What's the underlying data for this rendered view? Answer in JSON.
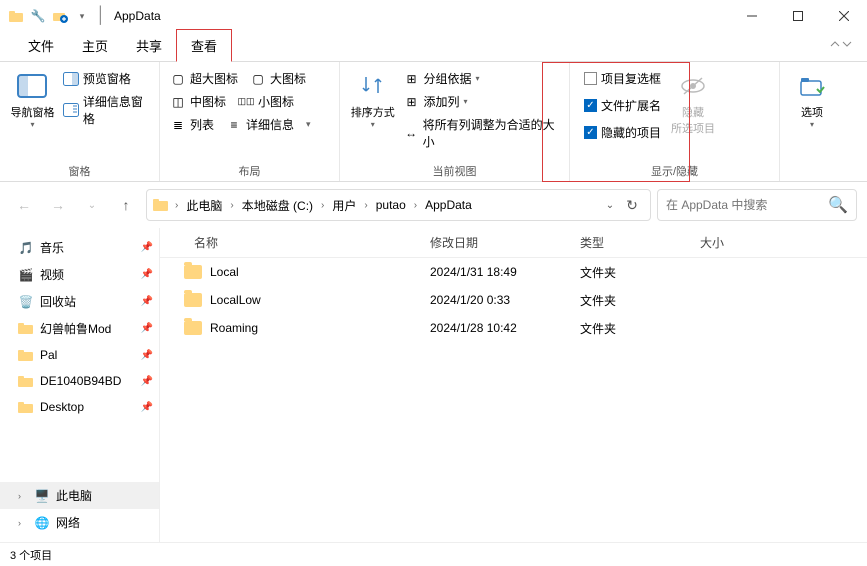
{
  "title": "AppData",
  "tabs": {
    "file": "文件",
    "home": "主页",
    "share": "共享",
    "view": "查看"
  },
  "ribbon": {
    "nav_pane": "导航窗格",
    "preview_pane": "预览窗格",
    "details_pane": "详细信息窗格",
    "panes_label": "窗格",
    "xl_icon": "超大图标",
    "l_icon": "大图标",
    "m_icon": "中图标",
    "s_icon": "小图标",
    "list": "列表",
    "details": "详细信息",
    "layout_label": "布局",
    "sort": "排序方式",
    "group": "分组依据",
    "addcol": "添加列",
    "fit": "将所有列调整为合适的大小",
    "view_label": "当前视图",
    "checkboxes": "项目复选框",
    "ext": "文件扩展名",
    "hidden": "隐藏的项目",
    "hide_sel": "隐藏\n所选项目",
    "options": "选项",
    "showhide_label": "显示/隐藏"
  },
  "breadcrumb": [
    "此电脑",
    "本地磁盘 (C:)",
    "用户",
    "putao",
    "AppData"
  ],
  "search_ph": "在 AppData 中搜索",
  "columns": {
    "name": "名称",
    "date": "修改日期",
    "type": "类型",
    "size": "大小"
  },
  "quick": [
    {
      "label": "音乐",
      "color": "#e74c3c",
      "icon": "music"
    },
    {
      "label": "视频",
      "color": "#8e44ad",
      "icon": "video"
    },
    {
      "label": "回收站",
      "color": "#5c99c7",
      "icon": "bin"
    },
    {
      "label": "幻兽帕鲁Mod",
      "color": "#ffd680",
      "icon": "folder"
    },
    {
      "label": "Pal",
      "color": "#ffd680",
      "icon": "folder"
    },
    {
      "label": "DE1040B94BD",
      "color": "#ffd680",
      "icon": "folder"
    },
    {
      "label": "Desktop",
      "color": "#ffd680",
      "icon": "folder"
    }
  ],
  "tree": {
    "pc": "此电脑",
    "net": "网络"
  },
  "files": [
    {
      "name": "Local",
      "date": "2024/1/31 18:49",
      "type": "文件夹"
    },
    {
      "name": "LocalLow",
      "date": "2024/1/20 0:33",
      "type": "文件夹"
    },
    {
      "name": "Roaming",
      "date": "2024/1/28 10:42",
      "type": "文件夹"
    }
  ],
  "status": "3 个项目",
  "checks": {
    "checkboxes": false,
    "ext": true,
    "hidden": true
  }
}
